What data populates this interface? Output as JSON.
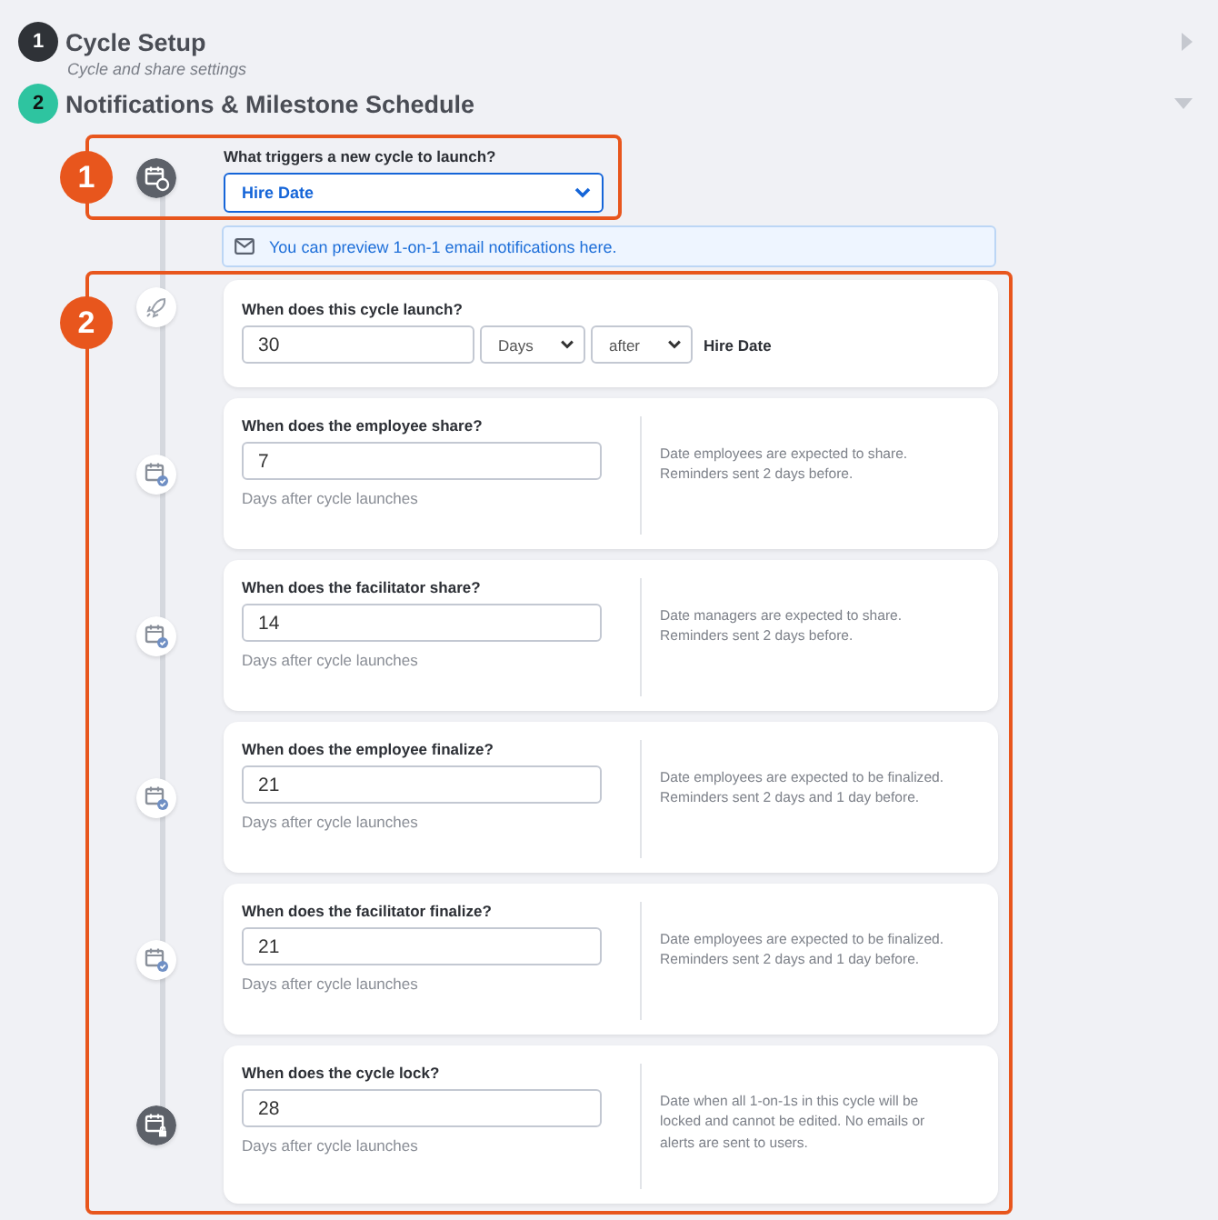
{
  "sections": [
    {
      "number": "1",
      "title": "Cycle Setup",
      "subtitle": "Cycle and share settings",
      "expanded": false,
      "color": "#2f3237"
    },
    {
      "number": "2",
      "title": "Notifications & Milestone Schedule",
      "expanded": true,
      "color": "#2ec4a0"
    }
  ],
  "trigger": {
    "callout": "1",
    "label": "What triggers a new cycle to launch?",
    "value": "Hire Date"
  },
  "notice": "You can preview 1-on-1 email notifications here.",
  "schedule": {
    "callout": "2",
    "steps": [
      {
        "kind": "launch",
        "label": "When does this cycle launch?",
        "value": "30",
        "unit": "Days",
        "direction": "after",
        "anchor": "Hire Date"
      },
      {
        "kind": "milestone",
        "label": "When does the employee share?",
        "value": "7",
        "hint": "Days after cycle launches",
        "description": "Date employees are expected to share. Reminders sent 2 days before."
      },
      {
        "kind": "milestone",
        "label": "When does the facilitator share?",
        "value": "14",
        "hint": "Days after cycle launches",
        "description": "Date managers are expected to share. Reminders sent 2 days before."
      },
      {
        "kind": "milestone",
        "label": "When does the employee finalize?",
        "value": "21",
        "hint": "Days after cycle launches",
        "description": "Date employees are expected to be finalized. Reminders sent 2 days and 1 day before."
      },
      {
        "kind": "milestone",
        "label": "When does the facilitator finalize?",
        "value": "21",
        "hint": "Days after cycle launches",
        "description": "Date employees are expected to be finalized. Reminders sent 2 days and 1 day before."
      },
      {
        "kind": "lock",
        "label": "When does the cycle lock?",
        "value": "28",
        "hint": "Days after cycle launches",
        "description": "Date when all 1-on-1s in this cycle will be locked and cannot be edited. No emails or alerts are sent to users."
      }
    ]
  }
}
